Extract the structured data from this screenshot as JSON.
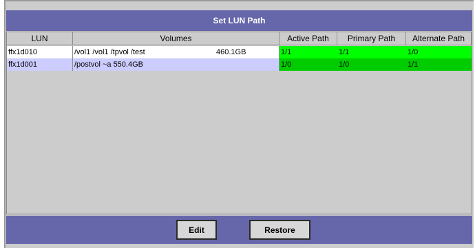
{
  "title": "Set LUN Path",
  "columns": [
    "LUN",
    "Volumes",
    "Active Path",
    "Primary Path",
    "Alternate Path"
  ],
  "rows": [
    {
      "lun": "ffx1d010",
      "volumes": "/vol1 /vol1 /tpvol /test",
      "size": "460.1GB",
      "active": "1/1",
      "primary": "1/1",
      "alternate": "1/0",
      "selected": false
    },
    {
      "lun": "ffx1d001",
      "volumes": "/postvol ~a 550.4GB",
      "size": "",
      "active": "1/0",
      "primary": "1/0",
      "alternate": "1/1",
      "selected": true
    }
  ],
  "buttons": {
    "edit": "Edit",
    "restore": "Restore"
  },
  "colors": {
    "title_bar": "#6666aa",
    "path_bright": "#00ff00",
    "path_dark": "#00cc00",
    "selected_row": "#ccccff"
  }
}
